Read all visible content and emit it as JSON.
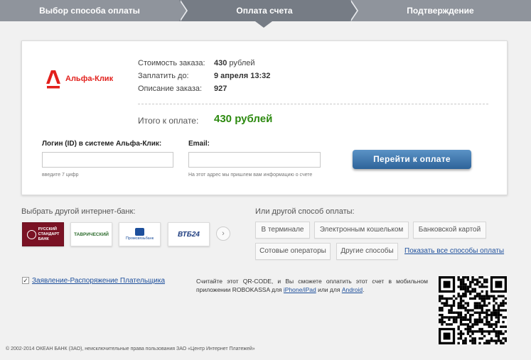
{
  "steps": {
    "step1": "Выбор способа оплаты",
    "step2": "Оплата счета",
    "step3": "Подтверждение"
  },
  "payment": {
    "logo_text": "Альфа-Клик",
    "order_cost_label": "Стоимость заказа:",
    "order_cost_value": "430",
    "order_cost_unit": "рублей",
    "pay_until_label": "Заплатить до:",
    "pay_until_value": "9 апреля 13:32",
    "description_label": "Описание заказа:",
    "description_value": "927",
    "total_label": "Итого к оплате:",
    "total_value": "430 рублей",
    "login_label": "Логин (ID) в системе Альфа-Клик:",
    "login_value": "",
    "login_hint": "введите 7 цифр",
    "email_label": "Email:",
    "email_value": "",
    "email_hint": "На этот адрес мы пришлем вам информацию о счете",
    "pay_button": "Перейти к оплате"
  },
  "banks": {
    "title": "Выбрать другой интернет-банк:",
    "items": [
      {
        "name": "Русский Стандарт",
        "line1": "РУССКИЙ",
        "line2": "СТАНДАРТ",
        "line3": "БАНК"
      },
      {
        "name": "Таврический",
        "label": "ТАВРИЧЕСКИЙ"
      },
      {
        "name": "Промсвязьбанк",
        "label": "Промсвязьбанк"
      },
      {
        "name": "ВТБ24",
        "label": "ВТБ24"
      }
    ],
    "next_icon": "chevron-right-icon"
  },
  "methods": {
    "title": "Или другой способ оплаты:",
    "items": [
      "В терминале",
      "Электронным кошельком",
      "Банковской картой",
      "Сотовые операторы",
      "Другие способы"
    ],
    "show_all": "Показать все способы оплаты"
  },
  "statement": {
    "checked": true,
    "label": "Заявление-Распоряжение Плательщика"
  },
  "qr": {
    "text_before": "Считайте этот QR-CODE, и Вы сможете оплатить этот счет в мобильном приложении ROBOKASSA для ",
    "link_ios": "iPhone/iPad",
    "text_middle": " или для ",
    "link_android": "Android",
    "text_after": "."
  },
  "footer": "© 2002-2014 ОКЕАН БАНК (ЗАО), неисключительные права пользования ЗАО «Центр Интернет Платежей»",
  "colors": {
    "accent_red": "#e2201c",
    "total_green": "#2d8a10",
    "link_blue": "#1d4f9c",
    "button_blue": "#3a72a9"
  }
}
